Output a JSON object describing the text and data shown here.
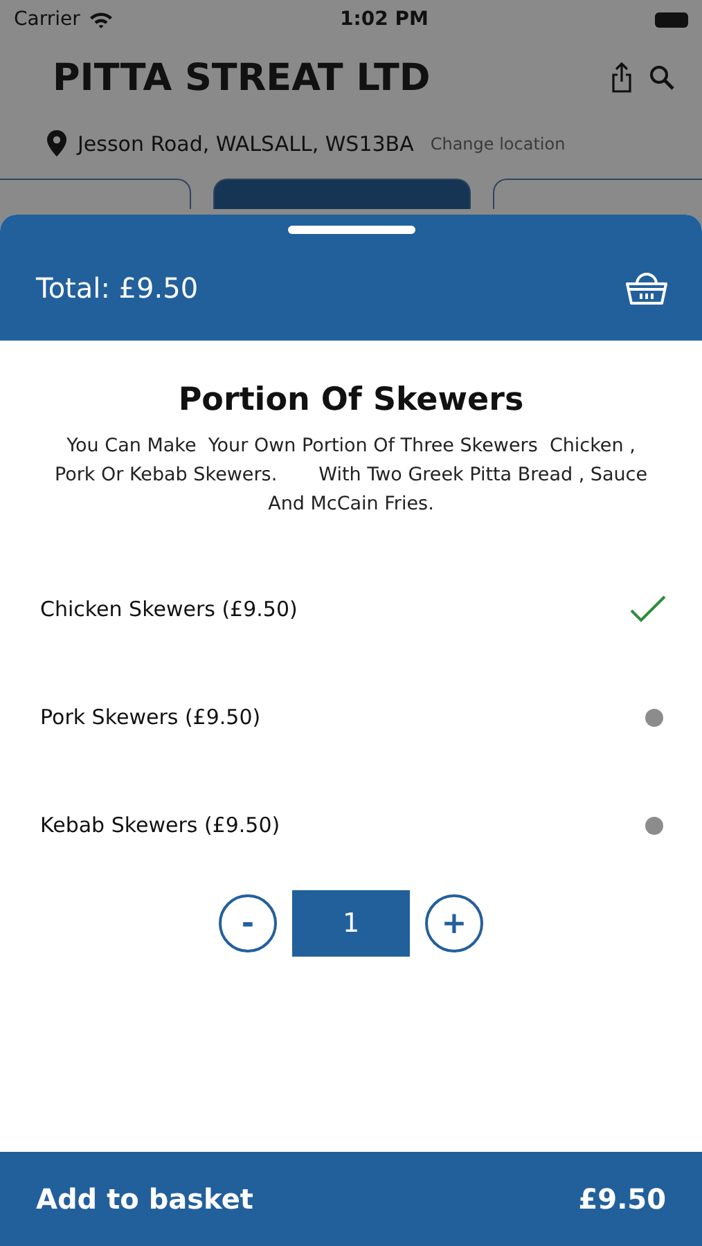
{
  "status_bar": {
    "carrier": "Carrier",
    "time": "1:02 PM"
  },
  "header": {
    "title": "PITTA STREAT LTD"
  },
  "location": {
    "address": "Jesson Road, WALSALL, WS13BA",
    "action": "Change location"
  },
  "tabs": [
    {
      "selected": false
    },
    {
      "selected": true
    },
    {
      "selected": false
    }
  ],
  "sheet": {
    "total": "Total: £9.50",
    "title": "Portion Of Skewers",
    "description": "You Can Make  Your Own Portion Of Three Skewers  Chicken , Pork Or Kebab Skewers.       With Two Greek Pitta Bread , Sauce And McCain Fries.",
    "options": [
      {
        "label": "Chicken Skewers (£9.50)",
        "selected": true
      },
      {
        "label": "Pork Skewers (£9.50)",
        "selected": false
      },
      {
        "label": "Kebab Skewers (£9.50)",
        "selected": false
      }
    ],
    "stepper": {
      "minus": "-",
      "quantity": "1",
      "plus": "+"
    }
  },
  "footer": {
    "label": "Add to basket",
    "price": "£9.50"
  }
}
